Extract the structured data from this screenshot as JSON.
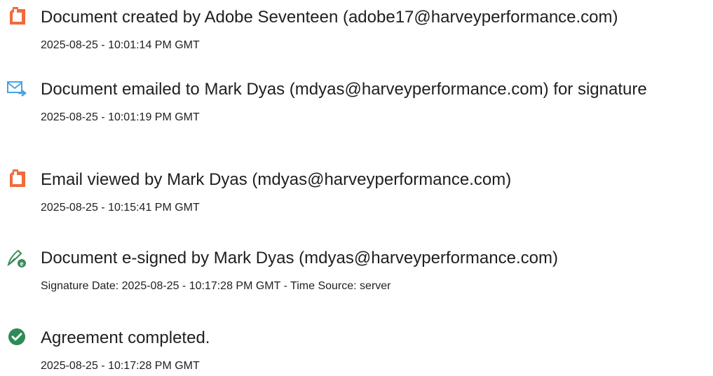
{
  "events": [
    {
      "icon": "document-created-icon",
      "title": "Document created by Adobe Seventeen (adobe17@harveyperformance.com)",
      "time": "2025-08-25 - 10:01:14 PM GMT"
    },
    {
      "icon": "document-emailed-icon",
      "title": "Document emailed to Mark Dyas (mdyas@harveyperformance.com) for signature",
      "time": "2025-08-25 - 10:01:19 PM GMT"
    },
    {
      "icon": "email-viewed-icon",
      "title": "Email viewed by Mark Dyas (mdyas@harveyperformance.com)",
      "time": "2025-08-25 - 10:15:41 PM GMT"
    },
    {
      "icon": "e-signed-icon",
      "title": "Document e-signed by Mark Dyas (mdyas@harveyperformance.com)",
      "time": "Signature Date: 2025-08-25 - 10:17:28 PM GMT - Time Source: server"
    },
    {
      "icon": "agreement-completed-icon",
      "title": "Agreement completed.",
      "time": "2025-08-25 - 10:17:28 PM GMT"
    }
  ],
  "colors": {
    "document_icon": "#f26b3a",
    "email_icon": "#4aa3df",
    "sign_icon": "#3a8a58",
    "completed_icon": "#2e8b57"
  }
}
